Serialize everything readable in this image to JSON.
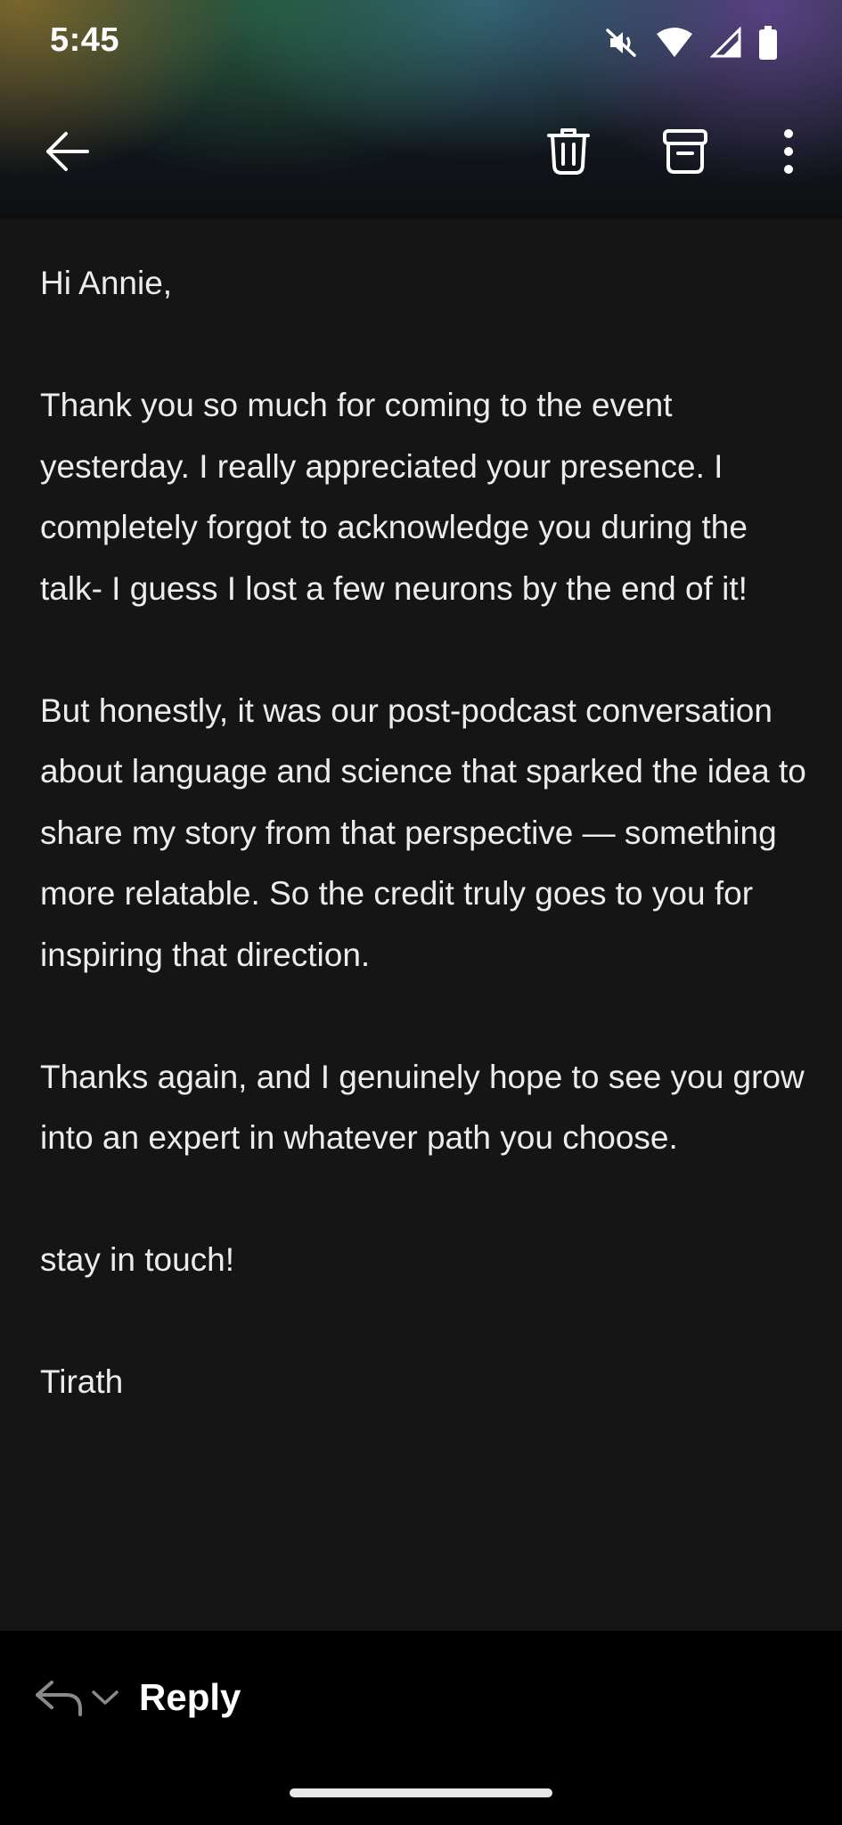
{
  "status_bar": {
    "time": "5:45",
    "icons": [
      "mute-vibrate-icon",
      "wifi-icon",
      "cell-signal-icon",
      "battery-icon"
    ]
  },
  "toolbar": {
    "icons": [
      "back-arrow-icon",
      "trash-icon",
      "archive-icon",
      "more-vert-icon"
    ]
  },
  "email": {
    "greeting": "Hi Annie,",
    "paragraph_1": "Thank you so much for coming to the event yesterday. I really appreciated your presence. I completely forgot to acknowledge you during the talk- I guess I lost a few neurons by the end of it!",
    "paragraph_2": "But honestly, it was our post-podcast conversation about language and science that sparked the idea to share my story from that perspective — something more relatable. So the credit truly goes to you for inspiring that direction.",
    "paragraph_3": "Thanks again, and I genuinely hope to see you grow into an expert in whatever path you choose.",
    "closing": "stay in touch!",
    "signature": "Tirath"
  },
  "reply_bar": {
    "reply_label": "Reply",
    "icons": [
      "reply-icon",
      "chevron-down-icon"
    ]
  },
  "colors": {
    "background": "#151515",
    "bottom_bar": "#000000",
    "text": "#ececec"
  }
}
